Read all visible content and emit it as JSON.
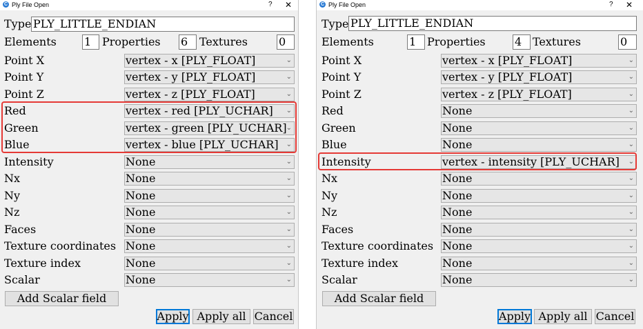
{
  "window_title": "Ply File Open",
  "help_glyph": "?",
  "close_glyph": "✕",
  "labels": {
    "type": "Type",
    "elements": "Elements",
    "properties": "Properties",
    "textures": "Textures",
    "point_x": "Point X",
    "point_y": "Point Y",
    "point_z": "Point Z",
    "red": "Red",
    "green": "Green",
    "blue": "Blue",
    "intensity": "Intensity",
    "nx": "Nx",
    "ny": "Ny",
    "nz": "Nz",
    "faces": "Faces",
    "texture_coordinates": "Texture coordinates",
    "texture_index": "Texture index",
    "scalar": "Scalar"
  },
  "buttons": {
    "add_scalar": "Add Scalar field",
    "apply": "Apply",
    "apply_all": "Apply all",
    "cancel": "Cancel"
  },
  "colors": {
    "highlight": "#e53935",
    "default_button_border": "#0078d7"
  },
  "left": {
    "type": "PLY_LITTLE_ENDIAN",
    "elements": "1",
    "properties": "6",
    "textures": "0",
    "point_x": "vertex - x [PLY_FLOAT]",
    "point_y": "vertex - y [PLY_FLOAT]",
    "point_z": "vertex - z [PLY_FLOAT]",
    "red": "vertex - red [PLY_UCHAR]",
    "green": "vertex - green [PLY_UCHAR]",
    "blue": "vertex - blue [PLY_UCHAR]",
    "intensity": "None",
    "nx": "None",
    "ny": "None",
    "nz": "None",
    "faces": "None",
    "texture_coordinates": "None",
    "texture_index": "None",
    "scalar": "None"
  },
  "right": {
    "type": "PLY_LITTLE_ENDIAN",
    "elements": "1",
    "properties": "4",
    "textures": "0",
    "point_x": "vertex - x [PLY_FLOAT]",
    "point_y": "vertex - y [PLY_FLOAT]",
    "point_z": "vertex - z [PLY_FLOAT]",
    "red": "None",
    "green": "None",
    "blue": "None",
    "intensity": "vertex - intensity [PLY_UCHAR]",
    "nx": "None",
    "ny": "None",
    "nz": "None",
    "faces": "None",
    "texture_coordinates": "None",
    "texture_index": "None",
    "scalar": "None"
  }
}
